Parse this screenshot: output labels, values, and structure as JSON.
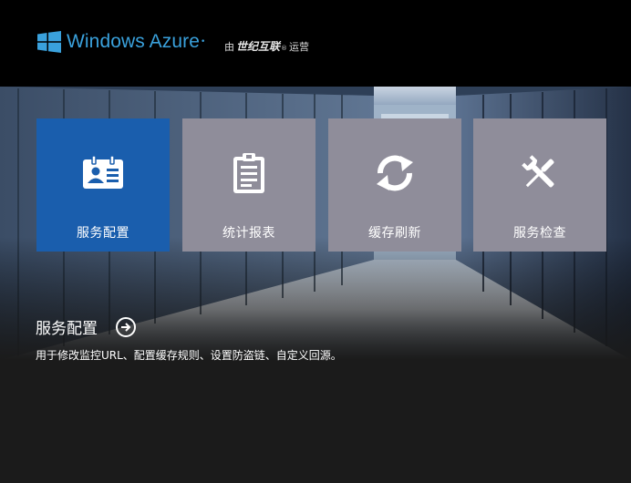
{
  "header": {
    "brand_name": "Windows Azure",
    "brand_tm": "•",
    "operator_prefix": "由",
    "operator_name": "世纪互联",
    "operator_reg": "®",
    "operator_suffix": "运营",
    "brand_color": "#3aa1dc"
  },
  "tiles": [
    {
      "label": "服务配置",
      "icon": "id-card-icon",
      "active": true
    },
    {
      "label": "统计报表",
      "icon": "clipboard-icon",
      "active": false
    },
    {
      "label": "缓存刷新",
      "icon": "refresh-icon",
      "active": false
    },
    {
      "label": "服务检查",
      "icon": "tools-icon",
      "active": false
    }
  ],
  "description": {
    "title": "服务配置",
    "text": "用于修改监控URL、配置缓存规则、设置防盗链、自定义回源。"
  },
  "colors": {
    "active_tile": "#1a5ead",
    "inactive_tile": "#8f8d9a",
    "background": "#000000"
  }
}
